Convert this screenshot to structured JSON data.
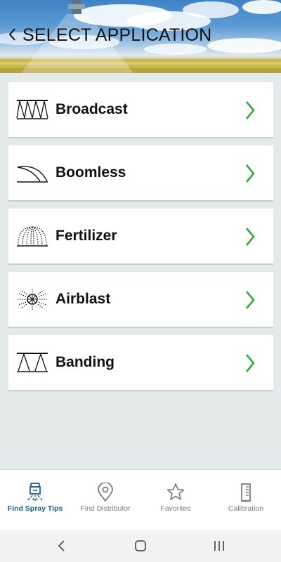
{
  "header": {
    "title": "SELECT APPLICATION",
    "back_icon": "chevron-left-icon"
  },
  "applications": [
    {
      "label": "Broadcast",
      "icon": "broadcast-spray-icon"
    },
    {
      "label": "Boomless",
      "icon": "boomless-spray-icon"
    },
    {
      "label": "Fertilizer",
      "icon": "fertilizer-spray-icon"
    },
    {
      "label": "Airblast",
      "icon": "airblast-spray-icon"
    },
    {
      "label": "Banding",
      "icon": "banding-spray-icon"
    }
  ],
  "bottom_nav": {
    "active": "Find Spray Tips",
    "tabs": [
      {
        "label": "Find Spray Tips",
        "icon": "spray-nozzle-icon"
      },
      {
        "label": "Find Distributor",
        "icon": "map-pin-icon"
      },
      {
        "label": "Favorites",
        "icon": "star-icon"
      },
      {
        "label": "Calibration",
        "icon": "measuring-cylinder-icon"
      }
    ]
  },
  "colors": {
    "accent_green": "#2fae3a",
    "active_tab_blue": "#1d5f8c",
    "background": "#e4e9e9"
  }
}
